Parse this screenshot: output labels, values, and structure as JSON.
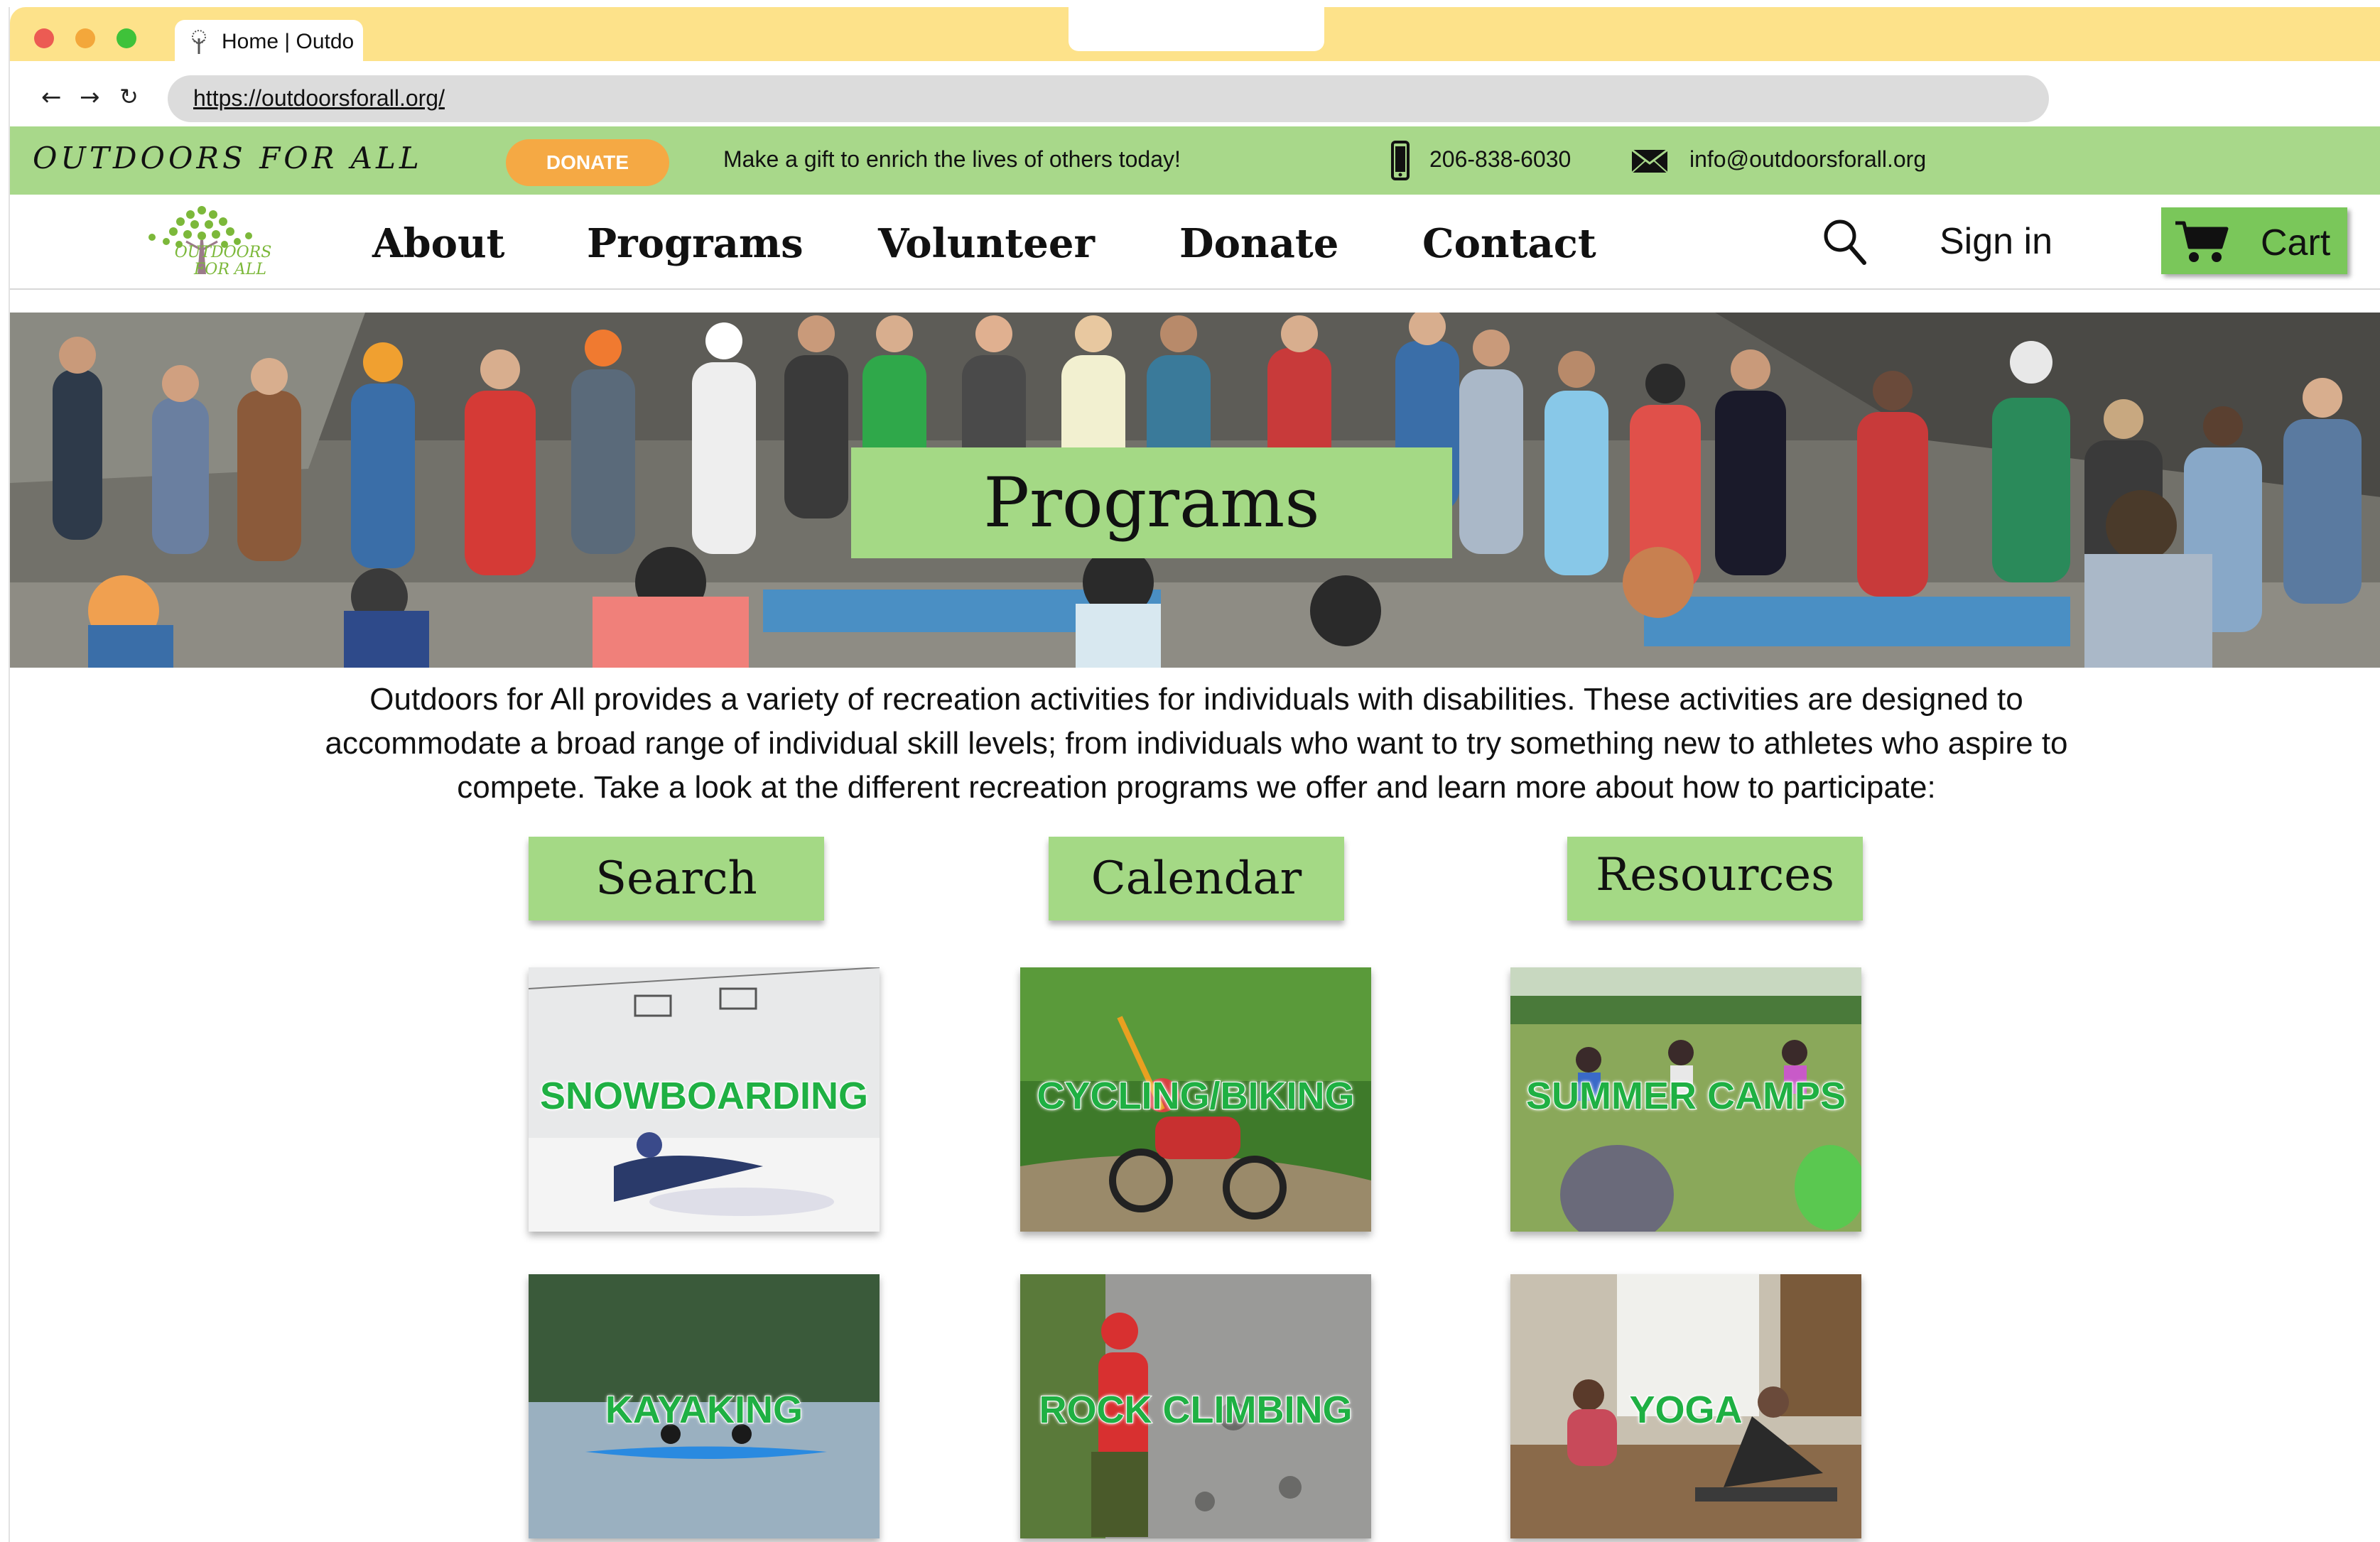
{
  "browser": {
    "tab_title": "Home | Outdo",
    "url": "https://outdoorsforall.org/"
  },
  "topbar": {
    "brand": "OUTDOORS FOR ALL",
    "donate_label": "DONATE",
    "tagline": "Make a gift to enrich the lives of others today!",
    "phone": "206-838-6030",
    "email": "info@outdoorsforall.org",
    "background_color": "#a8d88a",
    "donate_color": "#f5a944"
  },
  "nav": {
    "logo_text_top": "OUTDOORS",
    "logo_text_bottom": "FOR ALL",
    "items": [
      {
        "label": "About"
      },
      {
        "label": "Programs"
      },
      {
        "label": "Volunteer"
      },
      {
        "label": "Donate"
      },
      {
        "label": "Contact"
      }
    ],
    "signin_label": "Sign in",
    "cart_label": "Cart",
    "cart_color": "#7ac75a"
  },
  "hero": {
    "title": "Programs"
  },
  "intro": {
    "text": "Outdoors for All provides a variety of recreation activities for individuals with disabilities. These activities are designed to accommodate a broad range of individual skill levels; from individuals who want to try something new to athletes who aspire to compete. Take a look at the different recreation programs we offer and learn more about how to participate:"
  },
  "actions": [
    {
      "label": "Search"
    },
    {
      "label": "Calendar"
    },
    {
      "label": "Resources"
    }
  ],
  "programs": [
    {
      "label": "SNOWBOARDING"
    },
    {
      "label": "CYCLING/BIKING"
    },
    {
      "label": "SUMMER CAMPS"
    },
    {
      "label": "KAYAKING"
    },
    {
      "label": "ROCK CLIMBING"
    },
    {
      "label": "YOGA"
    }
  ],
  "colors": {
    "accent_green": "#a4d985",
    "label_green": "#1fb043",
    "tab_bar": "#fde28a"
  }
}
